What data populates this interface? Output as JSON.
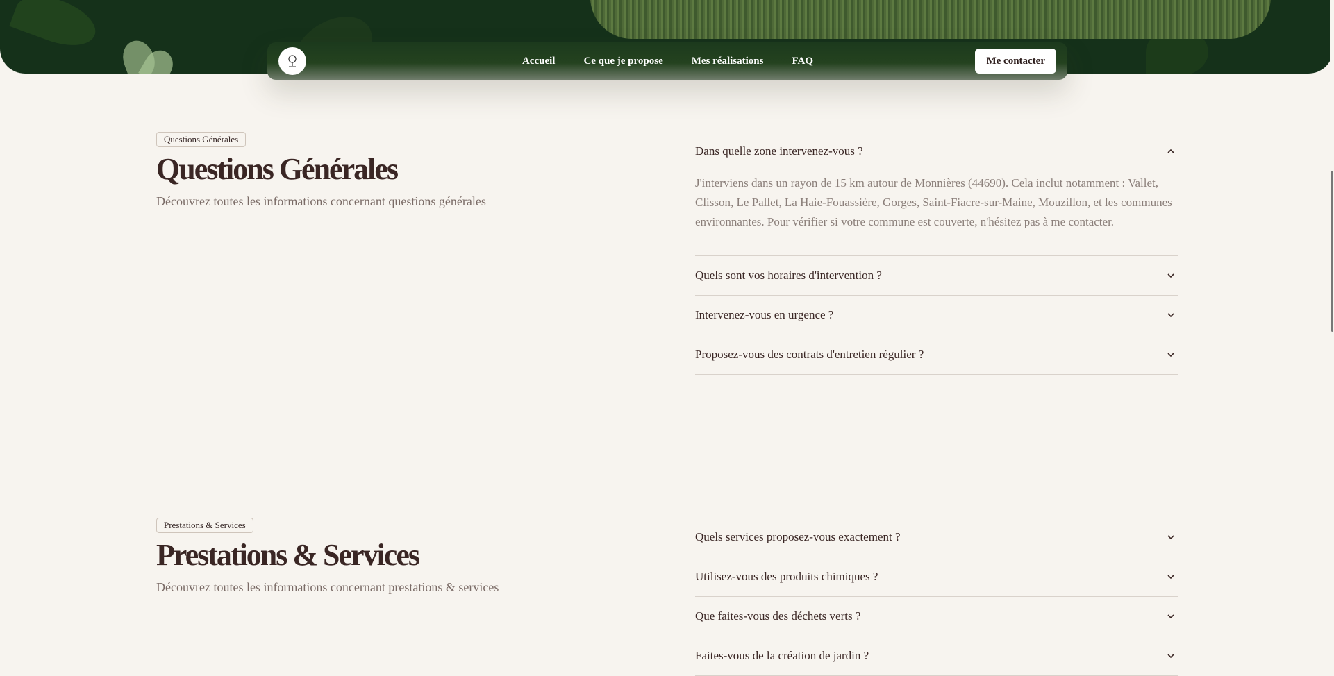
{
  "nav": {
    "links": [
      "Accueil",
      "Ce que je propose",
      "Mes réalisations",
      "FAQ"
    ],
    "contact": "Me contacter"
  },
  "sections": [
    {
      "badge": "Questions Générales",
      "title": "Questions Générales",
      "subtitle": "Découvrez toutes les informations concernant questions générales",
      "items": [
        {
          "q": "Dans quelle zone intervenez-vous ?",
          "open": true,
          "a": "J'interviens dans un rayon de 15 km autour de Monnières (44690). Cela inclut notamment : Vallet, Clisson, Le Pallet, La Haie-Fouassière, Gorges, Saint-Fiacre-sur-Maine, Mouzillon, et les communes environnantes. Pour vérifier si votre commune est couverte, n'hésitez pas à me contacter."
        },
        {
          "q": "Quels sont vos horaires d'intervention ?",
          "open": false
        },
        {
          "q": "Intervenez-vous en urgence ?",
          "open": false
        },
        {
          "q": "Proposez-vous des contrats d'entretien régulier ?",
          "open": false
        }
      ]
    },
    {
      "badge": "Prestations & Services",
      "title": "Prestations & Services",
      "subtitle": "Découvrez toutes les informations concernant prestations & services",
      "items": [
        {
          "q": "Quels services proposez-vous exactement ?",
          "open": false
        },
        {
          "q": "Utilisez-vous des produits chimiques ?",
          "open": false
        },
        {
          "q": "Que faites-vous des déchets verts ?",
          "open": false
        },
        {
          "q": "Faites-vous de la création de jardin ?",
          "open": false
        }
      ]
    }
  ],
  "icons": {
    "logo": "tree-logo-icon",
    "collapse": "chevron-up-icon",
    "expand": "chevron-down-icon"
  },
  "colors": {
    "heading": "#3a2624",
    "background": "#f7f4ef",
    "hero": "#15311a",
    "muted": "#8b7f7a"
  }
}
